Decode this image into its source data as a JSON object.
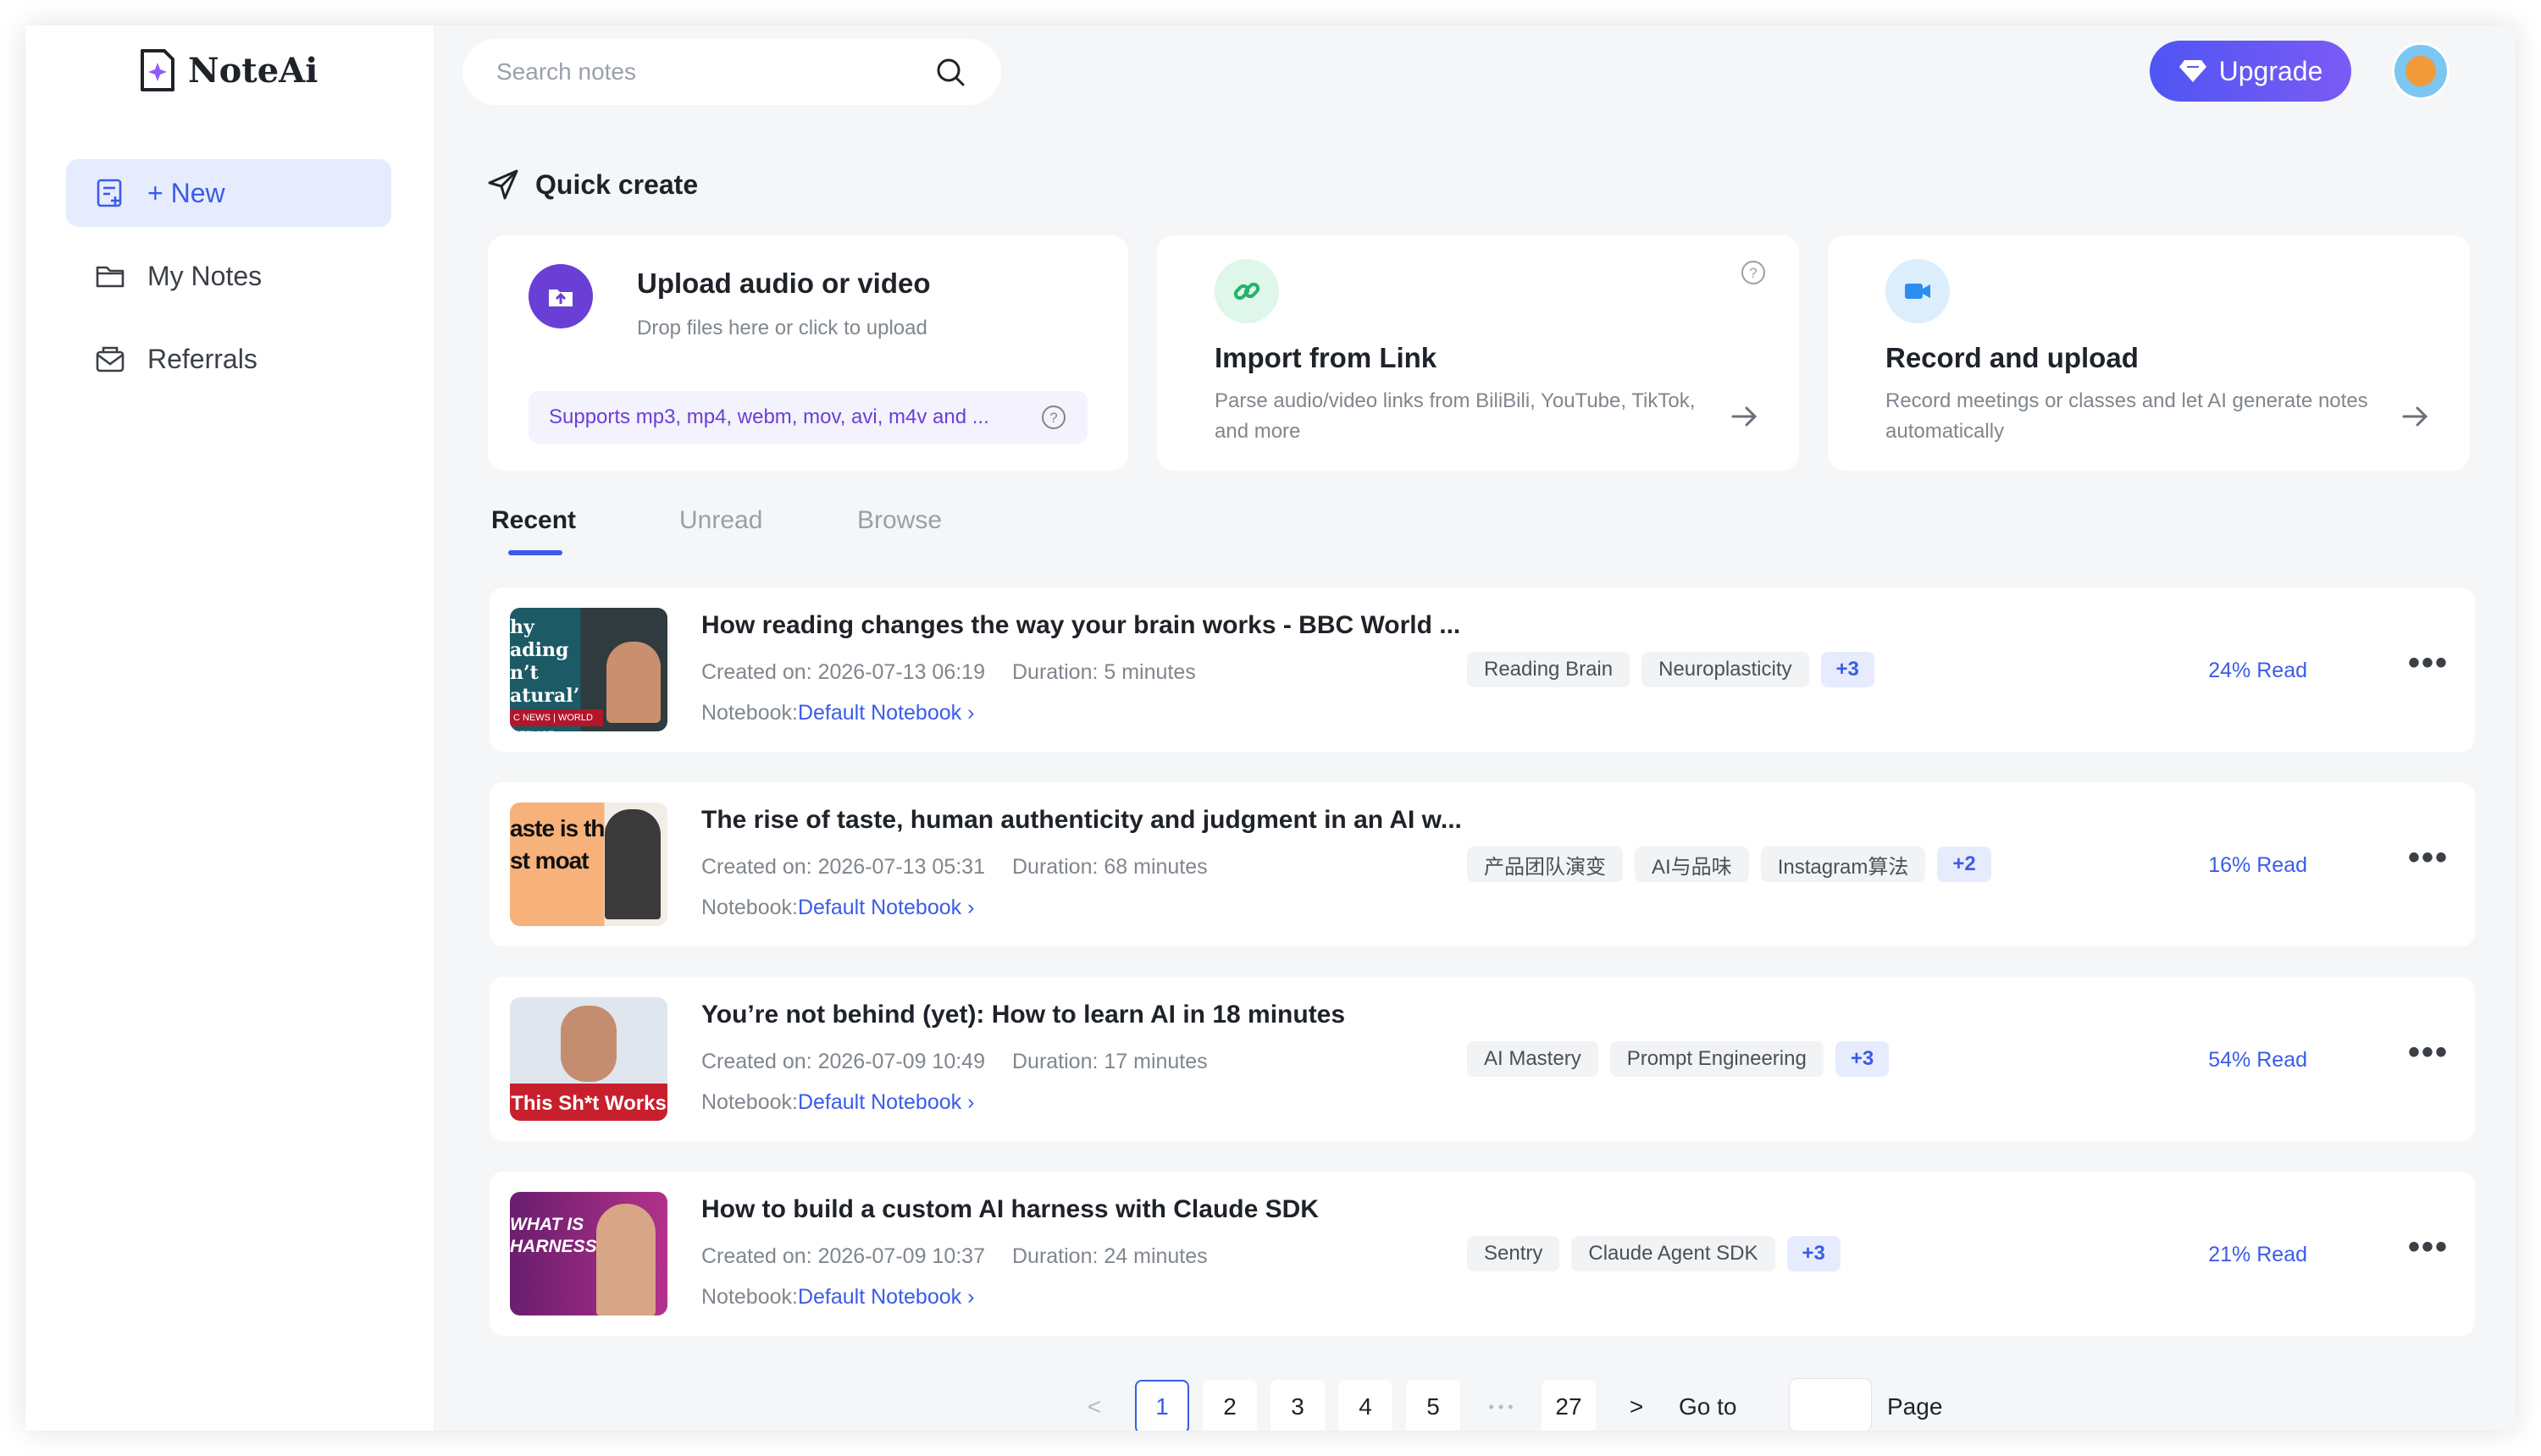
{
  "app": {
    "name": "NoteAi"
  },
  "sidebar": {
    "items": [
      {
        "label": "+ New",
        "icon": "new-note-icon"
      },
      {
        "label": "My Notes",
        "icon": "folder-icon"
      },
      {
        "label": "Referrals",
        "icon": "mail-icon"
      }
    ]
  },
  "header": {
    "search_placeholder": "Search notes",
    "upgrade_label": "Upgrade"
  },
  "quick_create": {
    "title": "Quick create",
    "cards": [
      {
        "title": "Upload audio or video",
        "desc": "Drop files here or click to upload",
        "support": "Supports mp3, mp4, webm, mov, avi, m4v and ..."
      },
      {
        "title": "Import from Link",
        "desc_line1": "Parse audio/video links from BiliBili, YouTube, TikTok,",
        "desc_line2": "and more"
      },
      {
        "title": "Record and upload",
        "desc_line1": "Record meetings or classes and let AI generate notes",
        "desc_line2": "automatically"
      }
    ]
  },
  "tabs": [
    "Recent",
    "Unread",
    "Browse"
  ],
  "notes": [
    {
      "title": "How reading changes the way your brain works - BBC World ...",
      "created": "Created on: 2026-07-13 06:19",
      "duration": "Duration: 5 minutes",
      "notebook_label": "Notebook:",
      "notebook": "Default Notebook",
      "tags": [
        "Reading Brain",
        "Neuroplasticity"
      ],
      "more": "+3",
      "read": "24% Read"
    },
    {
      "title": "The rise of taste, human authenticity and judgment in an AI w...",
      "created": "Created on: 2026-07-13 05:31",
      "duration": "Duration: 68 minutes",
      "notebook_label": "Notebook:",
      "notebook": "Default Notebook",
      "tags": [
        "产品团队演变",
        "AI与品味",
        "Instagram算法"
      ],
      "more": "+2",
      "read": "16% Read"
    },
    {
      "title": "You’re not behind (yet): How to learn AI in 18 minutes",
      "created": "Created on: 2026-07-09 10:49",
      "duration": "Duration: 17 minutes",
      "notebook_label": "Notebook:",
      "notebook": "Default Notebook",
      "tags": [
        "AI Mastery",
        "Prompt Engineering"
      ],
      "more": "+3",
      "read": "54% Read"
    },
    {
      "title": "How to build a custom AI harness with Claude SDK",
      "created": "Created on: 2026-07-09 10:37",
      "duration": "Duration: 24 minutes",
      "notebook_label": "Notebook:",
      "notebook": "Default Notebook",
      "tags": [
        "Sentry",
        "Claude Agent SDK"
      ],
      "more": "+3",
      "read": "21% Read"
    }
  ],
  "thumbnails": [
    {
      "lines": [
        "hy",
        "ading",
        "n’t",
        "atural’"
      ],
      "caption": "C NEWS | WORLD SERVICE"
    },
    {
      "lines": [
        "aste is the",
        "st moat"
      ]
    },
    {
      "lines": [
        "This Sh*t Works"
      ]
    },
    {
      "lines": [
        "WHAT IS",
        "HARNESS?"
      ]
    }
  ],
  "pagination": {
    "prev": "<",
    "pages": [
      "1",
      "2",
      "3",
      "4",
      "5"
    ],
    "ellipsis": "• • •",
    "last": "27",
    "next": ">",
    "current": "1",
    "goto_label": "Go to",
    "page_label": "Page"
  }
}
